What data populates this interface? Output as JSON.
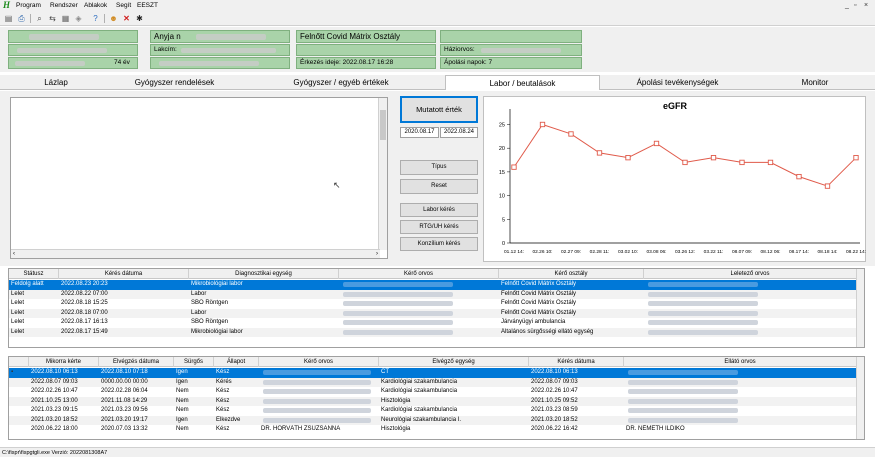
{
  "menu": [
    "Program",
    "Rendszer",
    "Ablakok",
    "Segít",
    "EESZT"
  ],
  "window_controls": [
    "_",
    "▫",
    "×"
  ],
  "patient": {
    "age": "74 év",
    "name_prefix": "Anyja n",
    "address_label": "Lakcím:",
    "ward": "Felnőtt Covid Mátrix Osztály",
    "arrival": "Érkezés ideje: 2022.08.17 16:28",
    "gp_label": "Háziorvos:",
    "care_days": "Ápolási napok: 7"
  },
  "tabs": [
    "Lázlap",
    "Gyógyszer rendelések",
    "Gyógyszer / egyéb értékek",
    "Labor / beutalások",
    "Ápolási tevékenységek",
    "Monitor"
  ],
  "active_tab": 3,
  "controls": {
    "shown_value_button": "Mutatott érték",
    "date_from": "2020.08.17",
    "date_to": "2022.08.24",
    "type_button": "Típus",
    "reset_button": "Reset",
    "lab_request_button": "Labor kérés",
    "rtg_button": "RTG/UH kérés",
    "consult_button": "Konzílium kérés"
  },
  "chart_data": {
    "type": "line",
    "title": "eGFR",
    "x": [
      "01.12 14:",
      "02.26 10:",
      "02.27 09:",
      "02.28 11:",
      "03.02 10:",
      "03.08 06:",
      "03.26 12:",
      "03.22 11:",
      "08.07 09:",
      "08.12 06:",
      "08.17 14:",
      "08.18 14:",
      "08.22 14:"
    ],
    "series": [
      {
        "values": [
          16,
          25,
          23,
          19,
          18,
          21,
          17,
          18,
          17,
          17,
          14,
          12,
          18
        ]
      }
    ],
    "ylim": [
      0,
      27
    ],
    "yticks": [
      0,
      5,
      10,
      15,
      20,
      25
    ],
    "color": "#e05a4a",
    "grid": false
  },
  "grid1": {
    "headers": [
      "Státusz",
      "Kérés dátuma",
      "Diagnosztikai egység",
      "Kérő orvos",
      "Kérő osztály",
      "Leletező orvos"
    ],
    "rows": [
      [
        "Feldolg alatt",
        "2022.08.23 20:23",
        "Mikrobiológiai labor",
        "",
        "Felnőtt Covid Mátrix Osztály",
        ""
      ],
      [
        "Lelet",
        "2022.08.22 07:00",
        "Labor",
        "",
        "Felnőtt Covid Mátrix Osztály",
        ""
      ],
      [
        "Lelet",
        "2022.08.18 15:25",
        "SBO Röntgen",
        "",
        "Felnőtt Covid Mátrix Osztály",
        ""
      ],
      [
        "Lelet",
        "2022.08.18 07:00",
        "Labor",
        "",
        "Felnőtt Covid Mátrix Osztály",
        ""
      ],
      [
        "Lelet",
        "2022.08.17 16:13",
        "SBO Röntgen",
        "",
        "Járványügyi ambulancia",
        ""
      ],
      [
        "Lelet",
        "2022.08.17 15:49",
        "Mikrobiológiai labor",
        "",
        "Általános sürgősségi ellátó egység",
        ""
      ]
    ]
  },
  "grid2": {
    "headers": [
      "",
      "Mikorra kérte",
      "Elvégzés dátuma",
      "Sürgős",
      "Állapot",
      "Kérő orvos",
      "Elvégző egység",
      "Kérés dátuma",
      "Ellátó orvos"
    ],
    "rows": [
      [
        "",
        "2022.08.10 06:13",
        "2022.08.10 07:18",
        "Igen",
        "Kész",
        "",
        "CT",
        "2022.08.10 06:13",
        ""
      ],
      [
        "",
        "2022.08.07 09:03",
        "0000.00.00 00:00",
        "Igen",
        "Kérés",
        "",
        "Kardiológiai szakambulancia",
        "2022.08.07 09:03",
        ""
      ],
      [
        "",
        "2022.02.26 10:47",
        "2022.02.28 06:04",
        "Nem",
        "Kész",
        "",
        "Kardiológiai szakambulancia",
        "2022.02.26 10:47",
        ""
      ],
      [
        "",
        "2021.10.25 13:00",
        "2021.11.08 14:29",
        "Nem",
        "Kész",
        "",
        "Hisztológia",
        "2021.10.25 09:52",
        ""
      ],
      [
        "",
        "2021.03.23 09:15",
        "2021.03.23 09:56",
        "Nem",
        "Kész",
        "",
        "Kardiológiai szakambulancia",
        "2021.03.23 08:59",
        ""
      ],
      [
        "",
        "2021.03.20 18:52",
        "2021.03.20 19:17",
        "Igen",
        "Elkezdve",
        "",
        "Neurológiai szakambulancia I.",
        "2021.03.20 18:52",
        ""
      ],
      [
        "",
        "2020.06.22 18:00",
        "2020.07.03 13:32",
        "Nem",
        "Kész",
        "DR. HORVÁTH ZSUZSANNA",
        "Hisztológia",
        "2020.06.22 16:42",
        "DR. NÉMETH ILDIKÓ"
      ]
    ]
  },
  "status_text": "C:\\fispr\\fispgtgli.exe Verzió: 2022081308A7"
}
